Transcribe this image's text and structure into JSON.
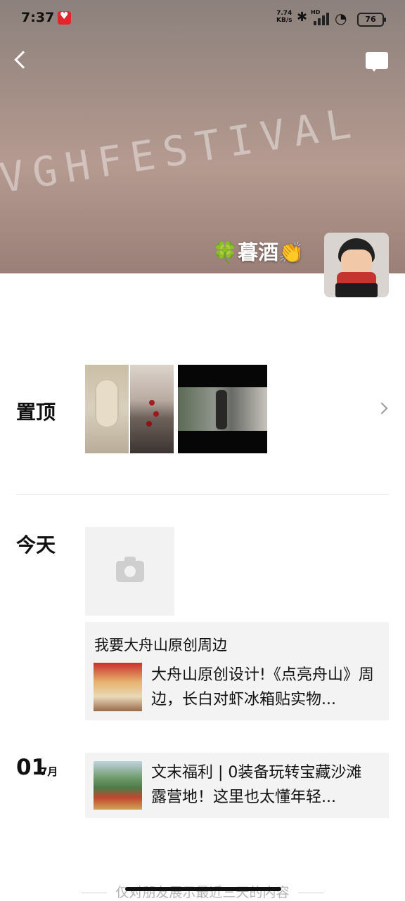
{
  "status_bar": {
    "time": "7:37",
    "net_speed_value": "7.74",
    "net_speed_unit": "KB/s",
    "hd_label": "HD",
    "battery": "76"
  },
  "cover": {
    "scrawl_text": "VGHFESTIVAL"
  },
  "profile": {
    "clover": "🍀",
    "name": "暮酒",
    "clap": "👏"
  },
  "sections": {
    "pinned_label": "置顶",
    "today_label": "今天"
  },
  "share_card": {
    "title": "我要大舟山原创周边",
    "text": "大舟山原创设计!《点亮舟山》周边，长白对虾冰箱贴实物..."
  },
  "date_entry": {
    "day": "01",
    "month": "7月"
  },
  "link_card": {
    "text": "文末福利 | 0装备玩转宝藏沙滩露营地！这里也太懂年轻..."
  },
  "footer": {
    "text": "仅对朋友展示最近三天的内容"
  }
}
